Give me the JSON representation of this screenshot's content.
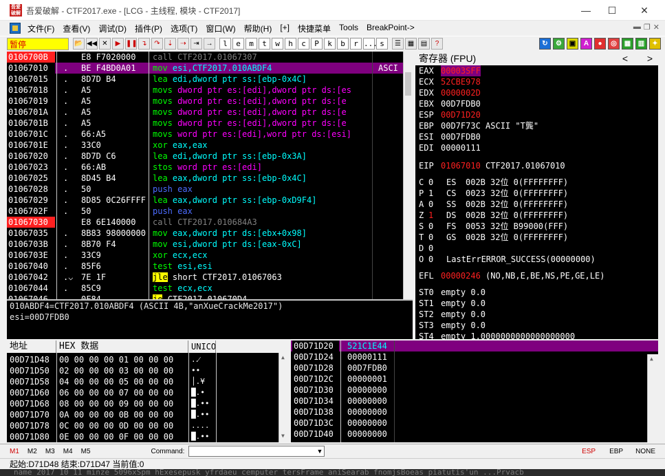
{
  "window": {
    "title": "吾爱破解 - CTF2017.exe - [LCG - 主线程, 模块 - CTF2017]",
    "app_icon_text": "吾爱破解",
    "minimize": "—",
    "maximize": "☐",
    "close": "✕"
  },
  "menubar": {
    "items": [
      "文件(F)",
      "查看(V)",
      "调试(D)",
      "插件(P)",
      "选项(T)",
      "窗口(W)",
      "帮助(H)",
      "[+]",
      "快捷菜单",
      "Tools",
      "BreakPoint->"
    ]
  },
  "toolbar": {
    "status": "暂停",
    "letters": [
      "l",
      "e",
      "m",
      "t",
      "w",
      "h",
      "c",
      "P",
      "k",
      "b",
      "r",
      "...",
      "s"
    ]
  },
  "disasm": {
    "rows": [
      {
        "addr": "0106700B",
        "mark": "",
        "hex": "E8 F7020000",
        "instr": "call CTF2017.01067307",
        "comment": "",
        "addr_hl": true
      },
      {
        "addr": "01067010",
        "mark": ".",
        "hex": "BE F4BD0A01",
        "instr": "mov esi,CTF2017.010ABDF4",
        "comment": "ASCI",
        "selected": true
      },
      {
        "addr": "01067015",
        "mark": ".",
        "hex": "8D7D B4",
        "instr": "lea edi,dword ptr ss:[ebp-0x4C]",
        "comment": ""
      },
      {
        "addr": "01067018",
        "mark": ".",
        "hex": "A5",
        "instr": "movs dword ptr es:[edi],dword ptr ds:[es",
        "comment": ""
      },
      {
        "addr": "01067019",
        "mark": ".",
        "hex": "A5",
        "instr": "movs dword ptr es:[edi],dword ptr ds:[e",
        "comment": ""
      },
      {
        "addr": "0106701A",
        "mark": ".",
        "hex": "A5",
        "instr": "movs dword ptr es:[edi],dword ptr ds:[e",
        "comment": ""
      },
      {
        "addr": "0106701B",
        "mark": ".",
        "hex": "A5",
        "instr": "movs dword ptr es:[edi],dword ptr ds:[e",
        "comment": ""
      },
      {
        "addr": "0106701C",
        "mark": ".",
        "hex": "66:A5",
        "instr": "movs word ptr es:[edi],word ptr ds:[esi]",
        "comment": ""
      },
      {
        "addr": "0106701E",
        "mark": ".",
        "hex": "33C0",
        "instr": "xor eax,eax",
        "comment": ""
      },
      {
        "addr": "01067020",
        "mark": ".",
        "hex": "8D7D C6",
        "instr": "lea edi,dword ptr ss:[ebp-0x3A]",
        "comment": ""
      },
      {
        "addr": "01067023",
        "mark": ".",
        "hex": "66:AB",
        "instr": "stos word ptr es:[edi]",
        "comment": ""
      },
      {
        "addr": "01067025",
        "mark": ".",
        "hex": "8D45 B4",
        "instr": "lea eax,dword ptr ss:[ebp-0x4C]",
        "comment": ""
      },
      {
        "addr": "01067028",
        "mark": ".",
        "hex": "50",
        "instr": "push eax",
        "comment": ""
      },
      {
        "addr": "01067029",
        "mark": ".",
        "hex": "8D85 0C26FFFF",
        "instr": "lea eax,dword ptr ss:[ebp-0xD9F4]",
        "comment": ""
      },
      {
        "addr": "0106702F",
        "mark": ".",
        "hex": "50",
        "instr": "push eax",
        "comment": ""
      },
      {
        "addr": "01067030",
        "mark": "",
        "hex": "E8 6E140000",
        "instr": "call CTF2017.010684A3",
        "comment": "",
        "addr_hl": true
      },
      {
        "addr": "01067035",
        "mark": ".",
        "hex": "8B83 98000000",
        "instr": "mov eax,dword ptr ds:[ebx+0x98]",
        "comment": ""
      },
      {
        "addr": "0106703B",
        "mark": ".",
        "hex": "8B70 F4",
        "instr": "mov esi,dword ptr ds:[eax-0xC]",
        "comment": ""
      },
      {
        "addr": "0106703E",
        "mark": ".",
        "hex": "33C9",
        "instr": "xor ecx,ecx",
        "comment": ""
      },
      {
        "addr": "01067040",
        "mark": ".",
        "hex": "85F6",
        "instr": "test esi,esi",
        "comment": ""
      },
      {
        "addr": "01067042",
        "mark": ".⌵",
        "hex": "7E 1F",
        "instr": "jle short CTF2017.01067063",
        "comment": ""
      },
      {
        "addr": "01067044",
        "mark": ".",
        "hex": "85C9",
        "instr": "test ecx,ecx",
        "comment": ""
      },
      {
        "addr": "01067046",
        "mark": "",
        "hex": "0F84 ...",
        "instr": "je CTF2017.010670D4",
        "comment": ""
      }
    ]
  },
  "info": {
    "line1": "010ABDF4=CTF2017.010ABDF4 (ASCII 4B,\"anXueCrackMe2017\")",
    "line2": "esi=00D7FDB0"
  },
  "registers": {
    "header": "寄存器 (FPU)",
    "gp": [
      {
        "name": "EAX",
        "value": "00003SFF",
        "comment": "",
        "highlight": "bg"
      },
      {
        "name": "ECX",
        "value": "52CBE978",
        "comment": "",
        "highlight": "red"
      },
      {
        "name": "EDX",
        "value": "0000002D",
        "comment": "",
        "highlight": "red"
      },
      {
        "name": "EBX",
        "value": "00D7FDB0",
        "comment": ""
      },
      {
        "name": "ESP",
        "value": "00D71D20",
        "comment": "",
        "highlight": "red"
      },
      {
        "name": "EBP",
        "value": "00D7F73C",
        "comment": "ASCII \"T龔\""
      },
      {
        "name": "ESI",
        "value": "00D7FDB0",
        "comment": ""
      },
      {
        "name": "EDI",
        "value": "00000111",
        "comment": ""
      }
    ],
    "eip": {
      "name": "EIP",
      "value": "01067010",
      "comment": "CTF2017.01067010"
    },
    "flags": [
      {
        "flag": "C",
        "val": "0",
        "seg": "ES",
        "sel": "002B",
        "bits": "32位",
        "info": "0(FFFFFFFF)"
      },
      {
        "flag": "P",
        "val": "1",
        "seg": "CS",
        "sel": "0023",
        "bits": "32位",
        "info": "0(FFFFFFFF)"
      },
      {
        "flag": "A",
        "val": "0",
        "seg": "SS",
        "sel": "002B",
        "bits": "32位",
        "info": "0(FFFFFFFF)"
      },
      {
        "flag": "Z",
        "val": "1",
        "seg": "DS",
        "sel": "002B",
        "bits": "32位",
        "info": "0(FFFFFFFF)",
        "val_red": true
      },
      {
        "flag": "S",
        "val": "0",
        "seg": "FS",
        "sel": "0053",
        "bits": "32位",
        "info": "B99000(FFF)"
      },
      {
        "flag": "T",
        "val": "0",
        "seg": "GS",
        "sel": "002B",
        "bits": "32位",
        "info": "0(FFFFFFFF)"
      },
      {
        "flag": "D",
        "val": "0",
        "seg": "",
        "sel": "",
        "bits": "",
        "info": ""
      },
      {
        "flag": "O",
        "val": "0",
        "seg": "LastErr",
        "sel": "ERROR_SUCCESS",
        "bits": "(00000000)",
        "info": ""
      }
    ],
    "efl": {
      "name": "EFL",
      "value": "00000246",
      "comment": "(NO,NB,E,BE,NS,PE,GE,LE)"
    },
    "fpu": [
      {
        "name": "ST0",
        "text": "empty 0.0"
      },
      {
        "name": "ST1",
        "text": "empty 0.0"
      },
      {
        "name": "ST2",
        "text": "empty 0.0"
      },
      {
        "name": "ST3",
        "text": "empty 0.0"
      },
      {
        "name": "ST4",
        "text": "empty 1.0000000000000000000"
      }
    ]
  },
  "dump": {
    "col_addr": "地址",
    "col_hex": "HEX 数据",
    "col_unicode": "UNICO",
    "rows": [
      {
        "addr": "00D71D48",
        "hex": "00 00 00 00 01 00 00 00",
        "uni": ".․⁄"
      },
      {
        "addr": "00D71D50",
        "hex": "02 00 00 00 03 00 00 00",
        "uni": "••"
      },
      {
        "addr": "00D71D58",
        "hex": "04 00 00 00 05 00 00 00",
        "uni": "│.¥"
      },
      {
        "addr": "00D71D60",
        "hex": "06 00 00 00 07 00 00 00",
        "uni": "█.•"
      },
      {
        "addr": "00D71D68",
        "hex": "08 00 00 00 09 00 00 00",
        "uni": "█.••"
      },
      {
        "addr": "00D71D70",
        "hex": "0A 00 00 00 0B 00 00 00",
        "uni": "█.••"
      },
      {
        "addr": "00D71D78",
        "hex": "0C 00 00 00 0D 00 00 00",
        "uni": "...."
      },
      {
        "addr": "00D71D80",
        "hex": "0E 00 00 00 0F 00 00 00",
        "uni": "█.••"
      }
    ]
  },
  "stack": {
    "top_addr": "00D71D20",
    "top_value": "521C1E44",
    "rows": [
      {
        "addr": "00D71D24",
        "value": "00000111"
      },
      {
        "addr": "00D71D28",
        "value": "00D7FDB0"
      },
      {
        "addr": "00D71D2C",
        "value": "00000001"
      },
      {
        "addr": "00D71D30",
        "value": "00000000"
      },
      {
        "addr": "00D71D34",
        "value": "00000000"
      },
      {
        "addr": "00D71D38",
        "value": "00000000"
      },
      {
        "addr": "00D71D3C",
        "value": "00000000"
      },
      {
        "addr": "00D71D40",
        "value": "00000000"
      }
    ]
  },
  "statusbar": {
    "tabs": [
      "M1",
      "M2",
      "M3",
      "M4",
      "M5"
    ],
    "command_label": "Command:",
    "command_value": "",
    "esp": "ESP",
    "ebp": "EBP",
    "none": "NONE",
    "line2": "起始:D71D48 结束:D71D47 当前值:0"
  },
  "background_strip": "name 2017_10_11   minze   5096xSpm  hExesepusk  yfrdaeu  cemputer  tersFrame aniSearab fnomjsBoeas  piatutis'un  ...Prvacb",
  "colors": {
    "yellow": "#ffff00",
    "magenta_instr": "#ff00ff",
    "cyan_instr": "#00ffff",
    "green_instr": "#00ff00",
    "blue_instr": "#4c6cff",
    "red_addr": "#ff2020",
    "selected_row": "#7f007f",
    "grey_text": "#808080"
  }
}
